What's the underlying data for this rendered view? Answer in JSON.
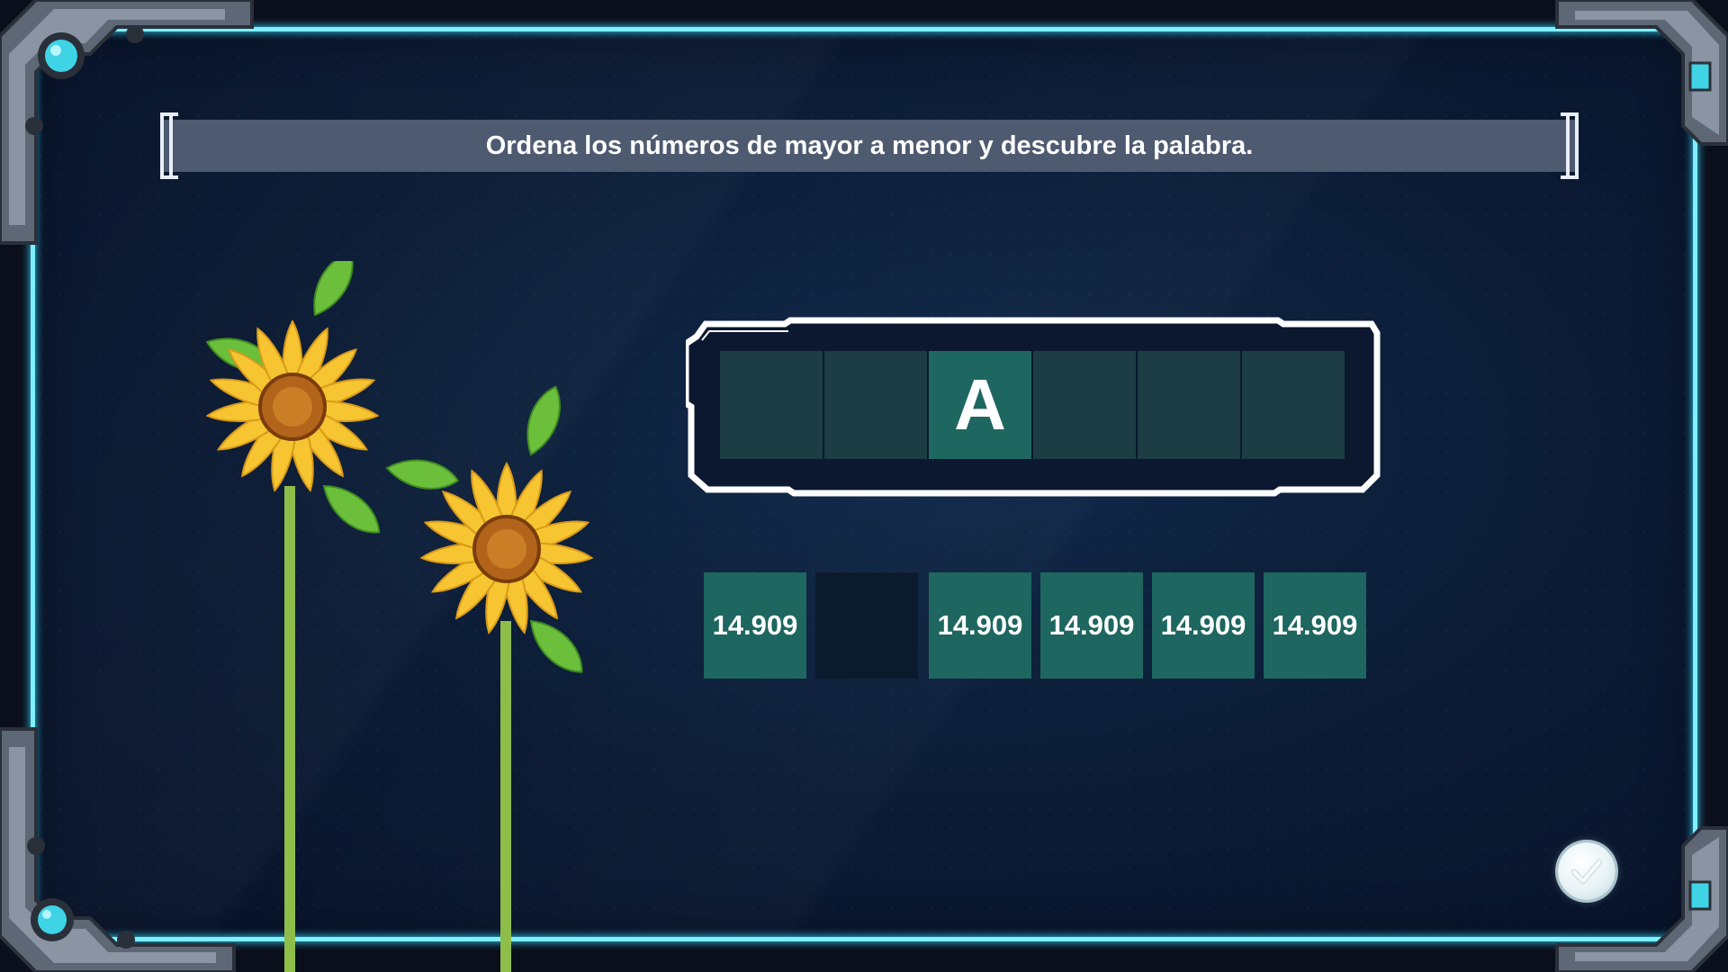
{
  "instruction": {
    "text": "Ordena los números de mayor a menor y descubre la palabra."
  },
  "word": {
    "letters": [
      "",
      "",
      "A",
      "",
      "",
      ""
    ]
  },
  "tiles": [
    {
      "label": "14.909",
      "empty": false
    },
    {
      "label": "",
      "empty": true
    },
    {
      "label": "14.909",
      "empty": false
    },
    {
      "label": "14.909",
      "empty": false
    },
    {
      "label": "14.909",
      "empty": false
    },
    {
      "label": "14.909",
      "empty": false
    }
  ],
  "colors": {
    "frame_glow": "#7ef0ff",
    "tile": "#1e6660",
    "slot": "#1b3d43",
    "instruction_bar": "#4d5a70"
  },
  "icons": {
    "check_button": "check-icon",
    "decoration": "sunflower-icon"
  }
}
